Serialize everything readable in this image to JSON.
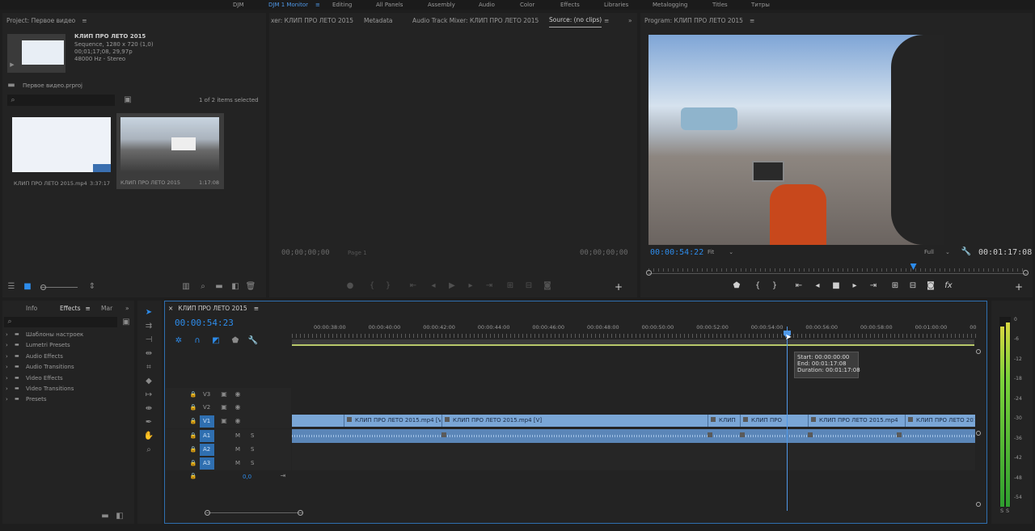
{
  "workspaces": [
    "DJM",
    "DJM 1 Monitor",
    "Editing",
    "All Panels",
    "Assembly",
    "Audio",
    "Color",
    "Effects",
    "Libraries",
    "Metalogging",
    "Titles",
    "Титры"
  ],
  "active_workspace_index": 1,
  "project": {
    "title": "Project: Первое видео",
    "seq_name": "КЛИП ПРО ЛЕТО 2015",
    "seq_info1": "Sequence, 1280 x 720 (1,0)",
    "seq_info2": "00;01;17;08, 29,97p",
    "seq_info3": "48000 Hz - Stereo",
    "file": "Первое видео.prproj",
    "selected": "1 of 2 items selected",
    "items": [
      {
        "name": "КЛИП ПРО ЛЕТО 2015.mp4",
        "duration": "3:37:17"
      },
      {
        "name": "КЛИП ПРО ЛЕТО 2015",
        "duration": "1:17:08"
      }
    ]
  },
  "source": {
    "tabs": [
      "xer: КЛИП ПРО ЛЕТО 2015",
      "Metadata",
      "Audio Track Mixer: КЛИП ПРО ЛЕТО 2015",
      "Source: (no clips)"
    ],
    "tc_left": "00;00;00;00",
    "tc_right": "00;00;00;00",
    "page": "Page 1"
  },
  "program": {
    "title": "Program: КЛИП ПРО ЛЕТО 2015",
    "tc": "00:00:54:22",
    "fit": "Fit",
    "full": "Full",
    "duration": "00:01:17:08",
    "playhead": 0.7
  },
  "effects_panel": {
    "tabs": [
      "Info",
      "Effects",
      "Mar"
    ],
    "items": [
      "Шаблоны настроек",
      "Lumetri Presets",
      "Audio Effects",
      "Audio Transitions",
      "Video Effects",
      "Video Transitions",
      "Presets"
    ]
  },
  "timeline": {
    "tab": "КЛИП ПРО ЛЕТО 2015",
    "tc": "00:00:54:23",
    "ruler": [
      "00:00:38:00",
      "00:00:40:00",
      "00:00:42:00",
      "00:00:44:00",
      "00:00:46:00",
      "00:00:48:00",
      "00:00:50:00",
      "00:00:52:00",
      "00:00:54:00",
      "00:00:56:00",
      "00:00:58:00",
      "00:01:00:00",
      "00"
    ],
    "tooltip": [
      "Start: 00:00:00:00",
      "End: 00:01:17:08",
      "Duration: 00:01:17:08"
    ],
    "tracks": [
      "V3",
      "V2",
      "V1",
      "A1",
      "A2",
      "A3"
    ],
    "m_label": "M",
    "s_label": "S",
    "master_value": "0,0",
    "v1_clips": [
      "КЛИП ПРО ЛЕТО 2015.mp4 [V]",
      "КЛИП ПРО ЛЕТО 2015.mp4 [V]",
      "КЛИП",
      "КЛИП ПРО",
      "КЛИП ПРО ЛЕТО 2015.mp4",
      "КЛИП ПРО ЛЕТО 2015.mp4"
    ]
  },
  "meter": {
    "scale": [
      "0",
      "-6",
      "-12",
      "-18",
      "-24",
      "-30",
      "-36",
      "-42",
      "-48",
      "-54"
    ],
    "s_labels": [
      "S",
      "S"
    ],
    "level_left": 0.95,
    "level_right": 0.97
  },
  "colors": {
    "accent": "#2d8ceb",
    "clip_video": "#7aa6d6",
    "clip_audio": "#6a94c4",
    "workarea": "#b8c86a"
  }
}
